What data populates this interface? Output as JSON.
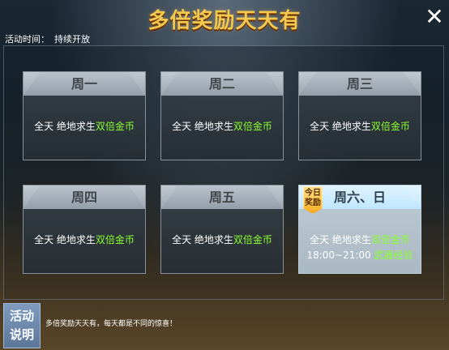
{
  "header": {
    "title": "多倍奖励天天有",
    "close_icon": "close-icon"
  },
  "activity": {
    "time_label": "活动时间：",
    "time_value": "持续开放"
  },
  "schedule": [
    {
      "day": "周一",
      "primary_prefix": "全天 绝地求生",
      "primary_highlight": "双倍金币"
    },
    {
      "day": "周二",
      "primary_prefix": "全天 绝地求生",
      "primary_highlight": "双倍金币"
    },
    {
      "day": "周三",
      "primary_prefix": "全天 绝地求生",
      "primary_highlight": "双倍金币"
    },
    {
      "day": "周四",
      "primary_prefix": "全天 绝地求生",
      "primary_highlight": "双倍金币"
    },
    {
      "day": "周五",
      "primary_prefix": "全天 绝地求生",
      "primary_highlight": "双倍金币"
    },
    {
      "day": "周六、日",
      "badge_line1": "今日",
      "badge_line2": "奖励",
      "primary_prefix": "全天 绝地求生",
      "primary_highlight": "双倍金币",
      "secondary_prefix": "18:00~21:00 ",
      "secondary_highlight": "武器经验"
    }
  ],
  "footer": {
    "button_line1": "活动",
    "button_line2": "说明",
    "description": "多倍奖励天天有，每天都是不同的惊喜！"
  },
  "colors": {
    "title": "#f3c84e",
    "highlight_green": "#8bff30",
    "footer_button": "#6f89ad"
  }
}
